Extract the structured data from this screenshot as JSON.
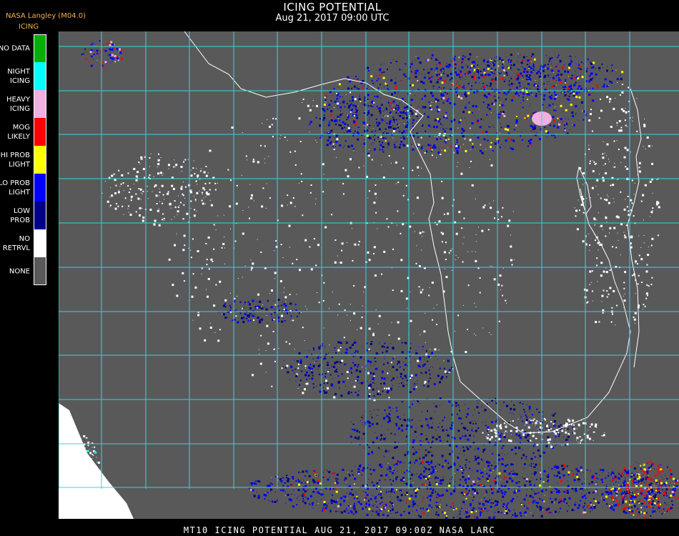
{
  "header": {
    "title": "ICING POTENTIAL",
    "datetime": "Aug 21, 2017 09:00 UTC",
    "source": "NASA Langley (M04.0)"
  },
  "legend": {
    "title": "ICING",
    "items": [
      {
        "label": "NO DATA",
        "color": "#00b000"
      },
      {
        "label": "NIGHT\nICING",
        "color": "#00ffff"
      },
      {
        "label": "HEAVY\nICING",
        "color": "#f0b0e0"
      },
      {
        "label": "MOG\nLIKELY",
        "color": "#ff0000"
      },
      {
        "label": "HI PROB\nLIGHT",
        "color": "#ffff00"
      },
      {
        "label": "LO PROB\nLIGHT",
        "color": "#0000ff"
      },
      {
        "label": "LOW\nPROB",
        "color": "#00008b"
      },
      {
        "label": "NO\nRETRVL",
        "color": "#ffffff"
      },
      {
        "label": "NONE",
        "color": "#595959"
      }
    ]
  },
  "map": {
    "grid_color": "#33d6e0",
    "label_color": "#c02020",
    "coastline_color": "#ffffff",
    "background": "#595959"
  },
  "footer": {
    "text": "MT10  ICING POTENTIAL   AUG 21, 2017 09:00Z   NASA LARC"
  }
}
